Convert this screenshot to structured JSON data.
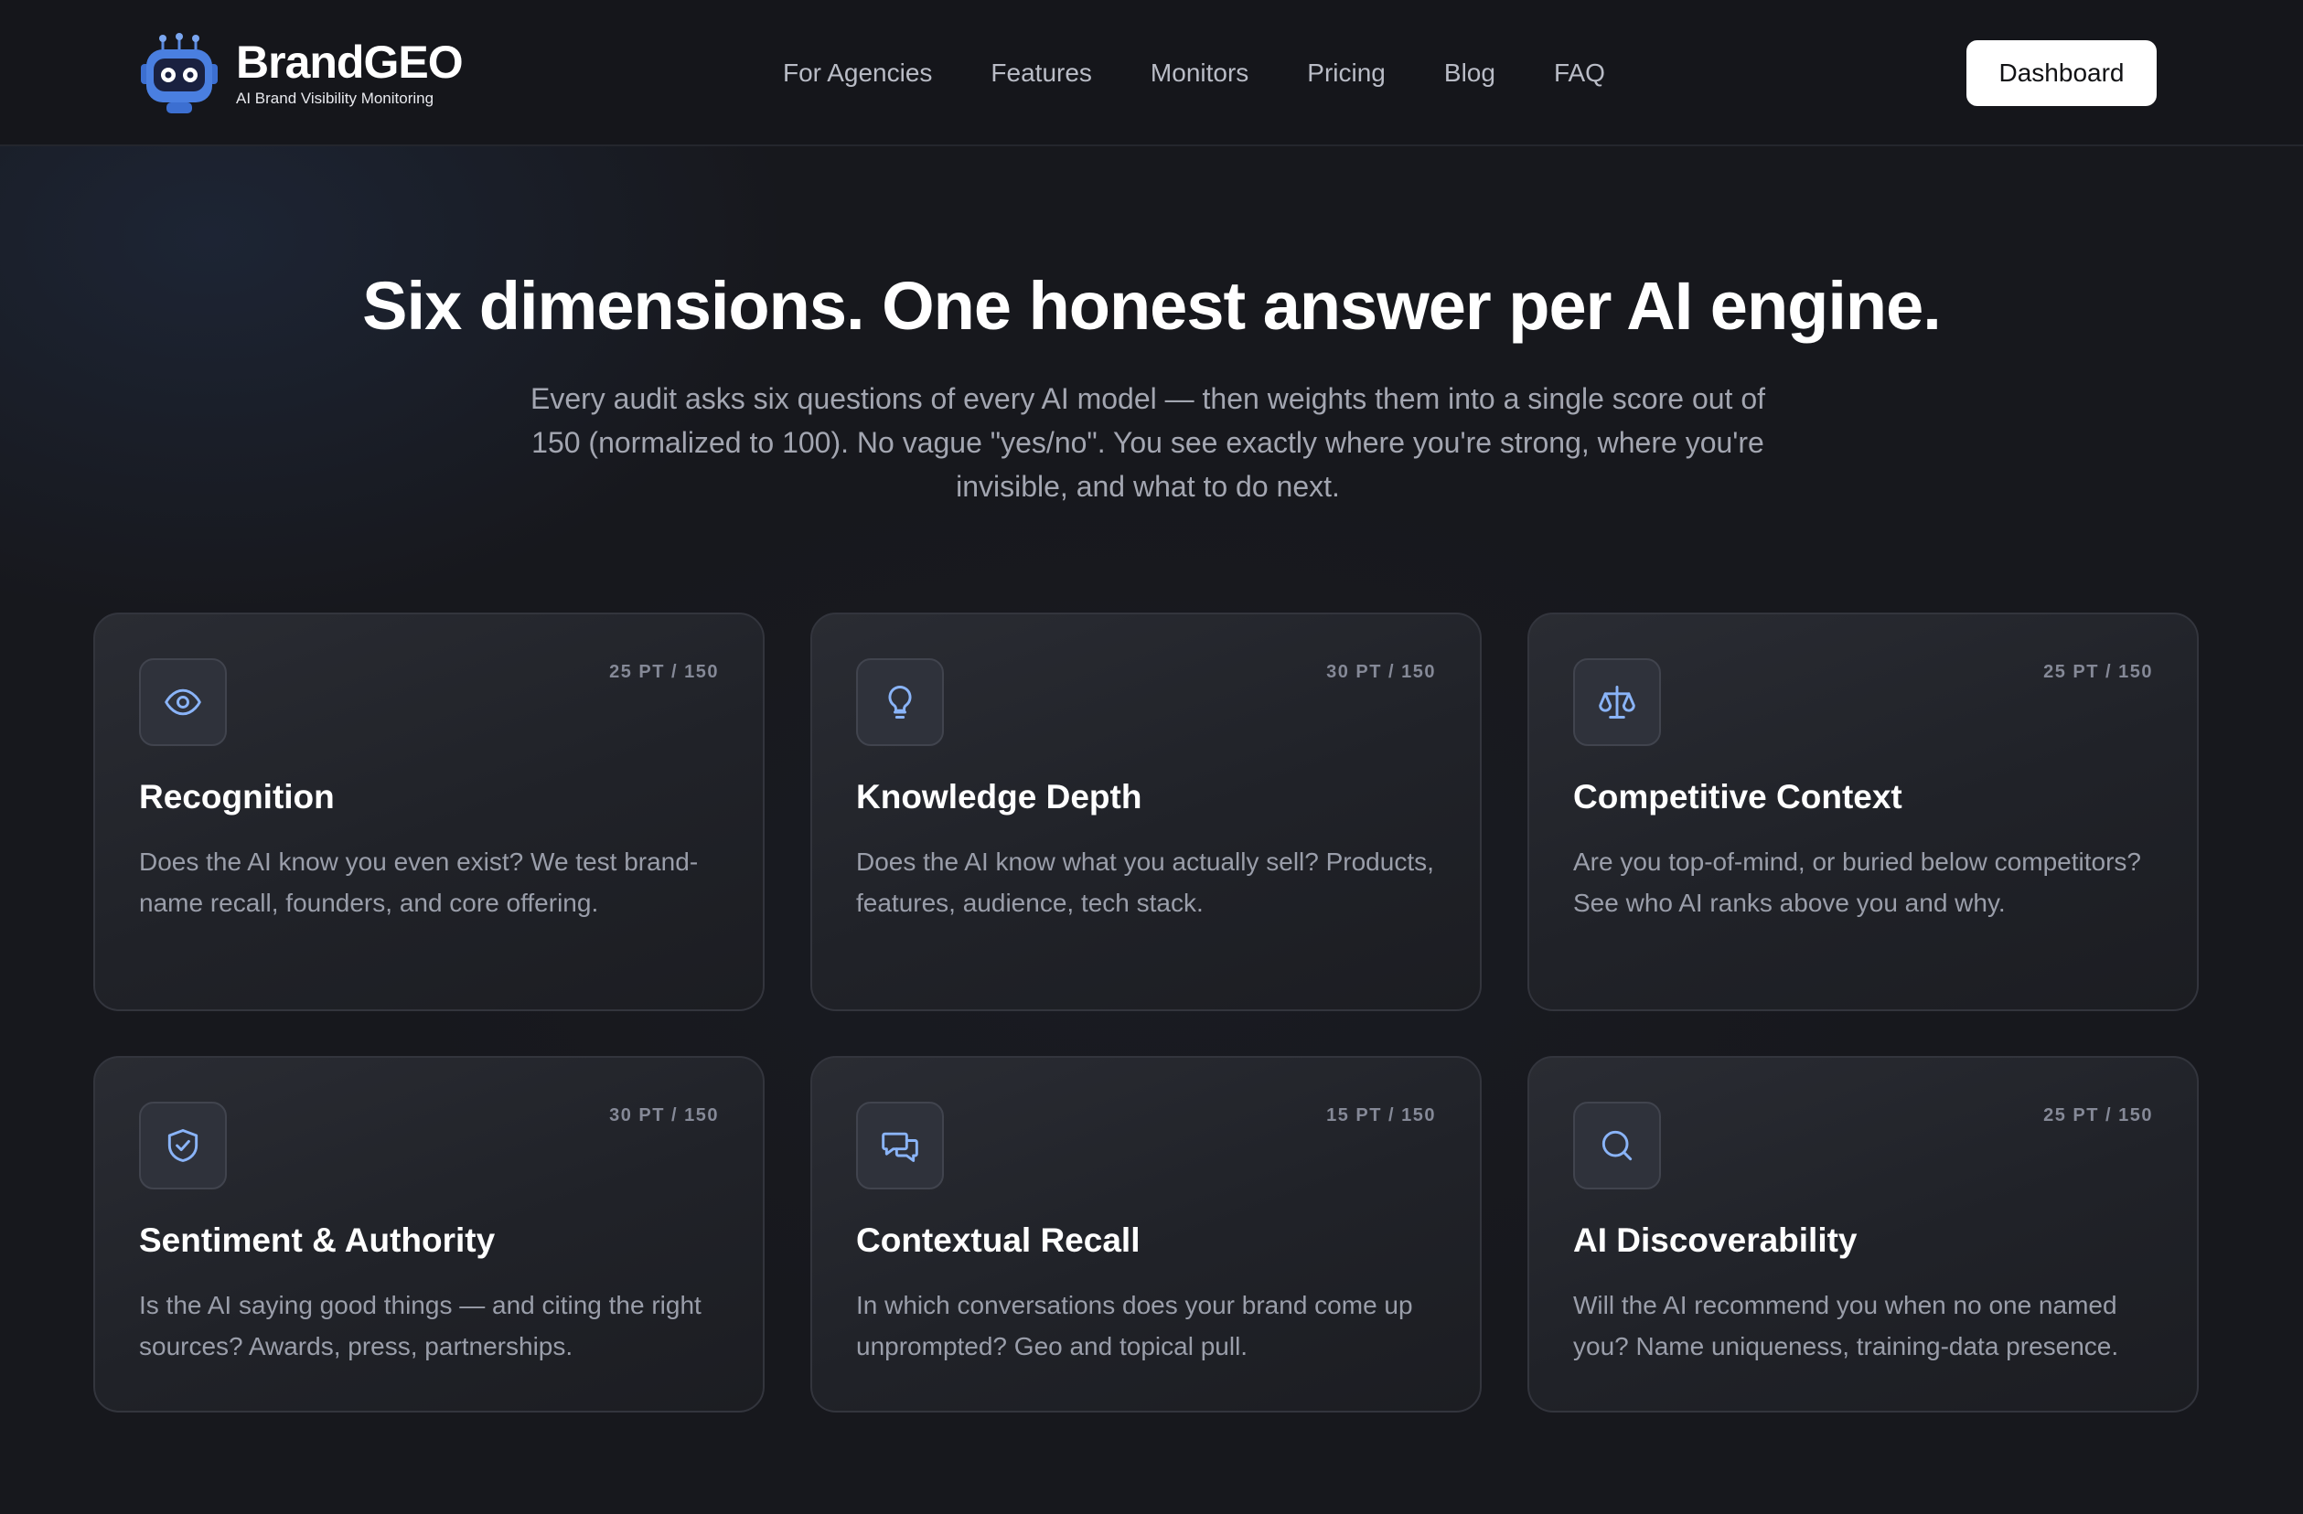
{
  "brand": {
    "name": "BrandGEO",
    "tagline": "AI Brand Visibility Monitoring"
  },
  "nav": [
    {
      "label": "For Agencies"
    },
    {
      "label": "Features"
    },
    {
      "label": "Monitors"
    },
    {
      "label": "Pricing"
    },
    {
      "label": "Blog"
    },
    {
      "label": "FAQ"
    }
  ],
  "header": {
    "cta_label": "Dashboard"
  },
  "hero": {
    "title": "Six dimensions. One honest answer per AI engine.",
    "subtitle": "Every audit asks six questions of every AI model — then weights them into a single score out of 150 (normalized to 100). No vague \"yes/no\". You see exactly where you're strong, where you're invisible, and what to do next."
  },
  "colors": {
    "background": "#17181d",
    "accent_icon": "#8ab4f8",
    "card_border": "#33353d"
  },
  "cards": [
    {
      "icon": "eye-icon",
      "points": "25 PT / 150",
      "title": "Recognition",
      "description": "Does the AI know you even exist? We test brand-name recall, founders, and core offering."
    },
    {
      "icon": "lightbulb-icon",
      "points": "30 PT / 150",
      "title": "Knowledge Depth",
      "description": "Does the AI know what you actually sell? Products, features, audience, tech stack."
    },
    {
      "icon": "scale-icon",
      "points": "25 PT / 150",
      "title": "Competitive Context",
      "description": "Are you top-of-mind, or buried below competitors? See who AI ranks above you and why."
    },
    {
      "icon": "shield-check-icon",
      "points": "30 PT / 150",
      "title": "Sentiment & Authority",
      "description": "Is the AI saying good things — and citing the right sources? Awards, press, partnerships."
    },
    {
      "icon": "chat-bubbles-icon",
      "points": "15 PT / 150",
      "title": "Contextual Recall",
      "description": "In which conversations does your brand come up unprompted? Geo and topical pull."
    },
    {
      "icon": "search-icon",
      "points": "25 PT / 150",
      "title": "AI Discoverability",
      "description": "Will the AI recommend you when no one named you? Name uniqueness, training-data presence."
    }
  ]
}
